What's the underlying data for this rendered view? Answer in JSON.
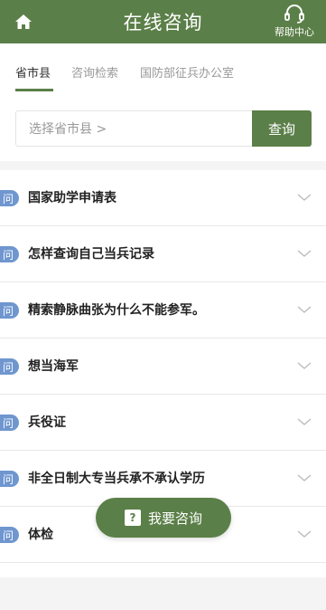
{
  "header": {
    "title": "在线咨询",
    "help_label": "帮助中心",
    "home_icon": "home-icon",
    "help_icon": "headset-icon",
    "bg_color": "#5b7f48"
  },
  "tabs": [
    {
      "label": "省市县",
      "active": true
    },
    {
      "label": "咨询检索",
      "active": false
    },
    {
      "label": "国防部征兵办公室",
      "active": false
    }
  ],
  "search": {
    "placeholder": "选择省市县 >",
    "button_label": "查询"
  },
  "faq": {
    "badge": "问",
    "items": [
      "国家助学申请表",
      "怎样查询自己当兵记录",
      "精索静脉曲张为什么不能参军。",
      "想当海军",
      "兵役证",
      "非全日制大专当兵承不承认学历",
      "体检"
    ]
  },
  "consult_button": {
    "label": "我要咨询",
    "icon_glyph": "?"
  }
}
